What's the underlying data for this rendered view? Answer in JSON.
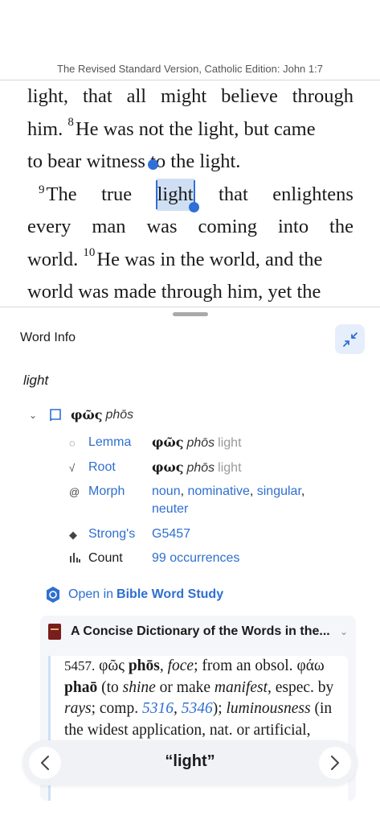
{
  "reader": {
    "reference": "The Revised Standard Version, Catholic Edition: John 1:7",
    "line1": [
      "light,",
      "that",
      "all",
      "might",
      "believe",
      "through"
    ],
    "line2_pre": "him. ",
    "verse8": "8",
    "line2_post": "He was not the light, but came",
    "line3": "to bear witness to the light.",
    "verse9": "9",
    "line4_first": "The",
    "line4_second": "true",
    "selected_word": "light",
    "line4_after": [
      "that",
      "enlightens"
    ],
    "line5": [
      "every",
      "man",
      "was",
      "coming",
      "into",
      "the"
    ],
    "line6_pre": "world. ",
    "verse10": "10",
    "line6_post": "He was in the world, and the",
    "line7": "world was made through him, yet the"
  },
  "panel": {
    "title": "Word Info",
    "headword": "light",
    "lemma_greek": "φῶς",
    "lemma_translit": "phōs",
    "rows": {
      "lemma": {
        "label": "Lemma",
        "greek": "φῶς",
        "translit": "phōs",
        "gloss": "light"
      },
      "root": {
        "label": "Root",
        "greek": "φως",
        "translit": "phōs",
        "gloss": "light"
      },
      "morph": {
        "label": "Morph",
        "parts": [
          "noun",
          "nominative",
          "singular",
          "neuter"
        ]
      },
      "strongs": {
        "label": "Strong's",
        "value": "G5457"
      },
      "count": {
        "label": "Count",
        "value": "99 occurrences"
      }
    },
    "open_study_prefix": "Open in",
    "open_study_name": "Bible Word Study"
  },
  "dictionary": {
    "title": "A Concise Dictionary of the Words in the...",
    "entry_number": "5457.",
    "greek": "φῶς",
    "translit": "phōs",
    "pron": "foce",
    "text1": "; from an obsol. ",
    "greek2": "φάω",
    "phao": "phaō",
    "text2": " (to ",
    "shine": "shine",
    "text3": " or make ",
    "manifest": "manifest",
    "text4": ", espec. by",
    "rays": "rays",
    "text5": "; comp. ",
    "ref1": "5316",
    "ref2": "5346",
    "text6": "); ",
    "luminousness": "luminousness",
    "text7": " (in",
    "line4": "the widest application, nat. or artificial,"
  },
  "bottom": {
    "title": "“light”"
  },
  "colors": {
    "accent": "#2e6fd0",
    "selection": "#cfdff3"
  }
}
